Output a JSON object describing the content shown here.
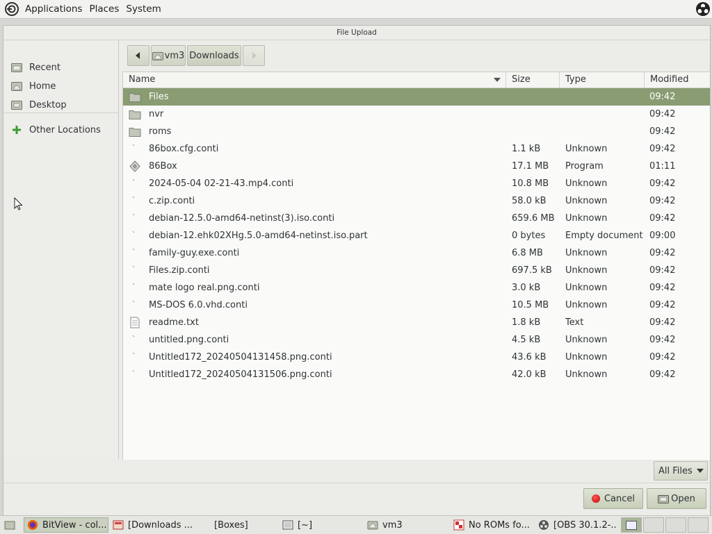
{
  "top_panel": {
    "menus": [
      "Applications",
      "Places",
      "System"
    ]
  },
  "dialog": {
    "title": "File Upload",
    "sidebar": {
      "items": [
        {
          "label": "Recent",
          "icon": "recent-folder-icon"
        },
        {
          "label": "Home",
          "icon": "home-folder-icon"
        },
        {
          "label": "Desktop",
          "icon": "desktop-folder-icon"
        },
        {
          "label": "Other Locations",
          "icon": "plus-icon"
        }
      ]
    },
    "pathbar": {
      "segments": [
        "vm3",
        "Downloads"
      ]
    },
    "columns": {
      "name": "Name",
      "size": "Size",
      "type": "Type",
      "modified": "Modified"
    },
    "files": [
      {
        "name": "Files",
        "size": "",
        "type": "",
        "modified": "09:42",
        "icon": "folder-icon",
        "selected": true
      },
      {
        "name": "nvr",
        "size": "",
        "type": "",
        "modified": "09:42",
        "icon": "folder-icon"
      },
      {
        "name": "roms",
        "size": "",
        "type": "",
        "modified": "09:42",
        "icon": "folder-icon"
      },
      {
        "name": "86box.cfg.conti",
        "size": "1.1 kB",
        "type": "Unknown",
        "modified": "09:42",
        "icon": "unknown-file-icon"
      },
      {
        "name": "86Box",
        "size": "17.1 MB",
        "type": "Program",
        "modified": "01:11",
        "icon": "executable-icon"
      },
      {
        "name": "2024-05-04 02-21-43.mp4.conti",
        "size": "10.8 MB",
        "type": "Unknown",
        "modified": "09:42",
        "icon": "unknown-file-icon"
      },
      {
        "name": "c.zip.conti",
        "size": "58.0 kB",
        "type": "Unknown",
        "modified": "09:42",
        "icon": "unknown-file-icon"
      },
      {
        "name": "debian-12.5.0-amd64-netinst(3).iso.conti",
        "size": "659.6 MB",
        "type": "Unknown",
        "modified": "09:42",
        "icon": "unknown-file-icon"
      },
      {
        "name": "debian-12.ehk02XHg.5.0-amd64-netinst.iso.part",
        "size": "0 bytes",
        "type": "Empty document",
        "modified": "09:00",
        "icon": "unknown-file-icon"
      },
      {
        "name": "family-guy.exe.conti",
        "size": "6.8 MB",
        "type": "Unknown",
        "modified": "09:42",
        "icon": "unknown-file-icon"
      },
      {
        "name": "Files.zip.conti",
        "size": "697.5 kB",
        "type": "Unknown",
        "modified": "09:42",
        "icon": "unknown-file-icon"
      },
      {
        "name": "mate logo real.png.conti",
        "size": "3.0 kB",
        "type": "Unknown",
        "modified": "09:42",
        "icon": "unknown-file-icon"
      },
      {
        "name": "MS-DOS 6.0.vhd.conti",
        "size": "10.5 MB",
        "type": "Unknown",
        "modified": "09:42",
        "icon": "unknown-file-icon"
      },
      {
        "name": "readme.txt",
        "size": "1.8 kB",
        "type": "Text",
        "modified": "09:42",
        "icon": "text-file-icon"
      },
      {
        "name": "untitled.png.conti",
        "size": "4.5 kB",
        "type": "Unknown",
        "modified": "09:42",
        "icon": "unknown-file-icon"
      },
      {
        "name": "Untitled172_20240504131458.png.conti",
        "size": "43.6 kB",
        "type": "Unknown",
        "modified": "09:42",
        "icon": "unknown-file-icon"
      },
      {
        "name": "Untitled172_20240504131506.png.conti",
        "size": "42.0 kB",
        "type": "Unknown",
        "modified": "09:42",
        "icon": "unknown-file-icon"
      }
    ],
    "filter": "All Files",
    "cancel_label": "Cancel",
    "open_label": "Open"
  },
  "taskbar": {
    "tasks": [
      {
        "label": "BitView - col...",
        "icon": "firefox-icon",
        "active": true
      },
      {
        "label": "[Downloads ...",
        "icon": "file-manager-icon"
      },
      {
        "label": "[Boxes]",
        "icon": "boxes-icon"
      },
      {
        "label": "[~]",
        "icon": "terminal-icon"
      },
      {
        "label": "vm3",
        "icon": "folder-icon"
      },
      {
        "label": "No ROMs fo...",
        "icon": "86box-icon"
      },
      {
        "label": "[OBS 30.1.2-...",
        "icon": "obs-icon"
      }
    ]
  }
}
